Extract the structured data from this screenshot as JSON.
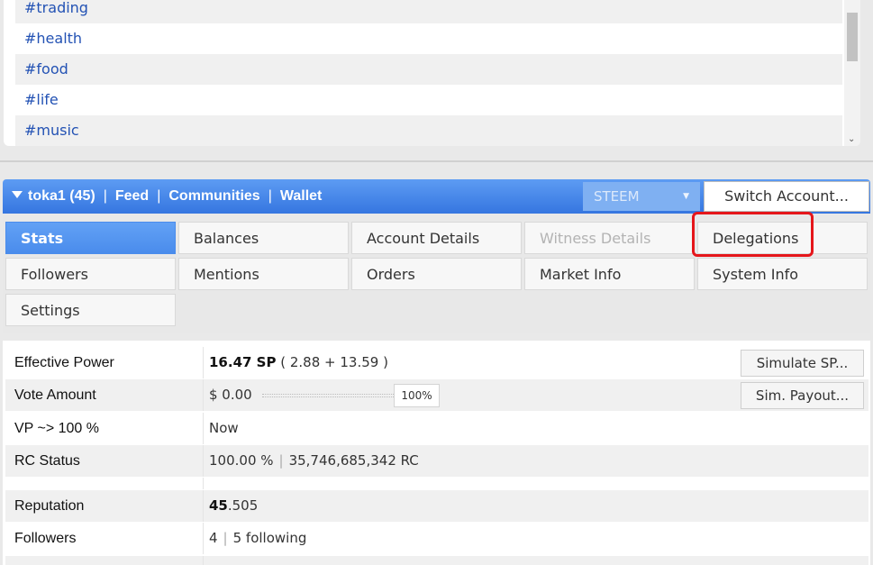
{
  "tags": [
    "#trading",
    "#health",
    "#food",
    "#life",
    "#music"
  ],
  "header": {
    "account": "toka1 (45)",
    "nav": [
      "Feed",
      "Communities",
      "Wallet"
    ],
    "separator": "|",
    "chain_select": "STEEM",
    "switch_account_label": "Switch Account..."
  },
  "tabs": [
    {
      "label": "Stats"
    },
    {
      "label": "Balances"
    },
    {
      "label": "Account Details"
    },
    {
      "label": "Witness Details"
    },
    {
      "label": "Delegations"
    },
    {
      "label": "Followers"
    },
    {
      "label": "Mentions"
    },
    {
      "label": "Orders"
    },
    {
      "label": "Market Info"
    },
    {
      "label": "System Info"
    },
    {
      "label": "Settings"
    }
  ],
  "stats": {
    "effective_power": {
      "label": "Effective Power",
      "value_bold": "16.47 SP",
      "value_rest": "( 2.88 + 13.59 )",
      "button": "Simulate SP..."
    },
    "vote_amount": {
      "label": "Vote Amount",
      "value": "$ 0.00",
      "percent": "100%",
      "button": "Sim. Payout..."
    },
    "vp": {
      "label": "VP ~> 100 %",
      "value": "Now"
    },
    "rc_status": {
      "label": "RC Status",
      "percent": "100.00 %",
      "rc": "35,746,685,342 RC"
    },
    "reputation": {
      "label": "Reputation",
      "value_bold": "45",
      "value_rest": ".505"
    },
    "followers": {
      "label": "Followers",
      "followers": "4",
      "following": "5 following"
    }
  },
  "colors": {
    "accent": "#4a8cec",
    "highlight": "#e5161b",
    "link": "#2352b4"
  }
}
